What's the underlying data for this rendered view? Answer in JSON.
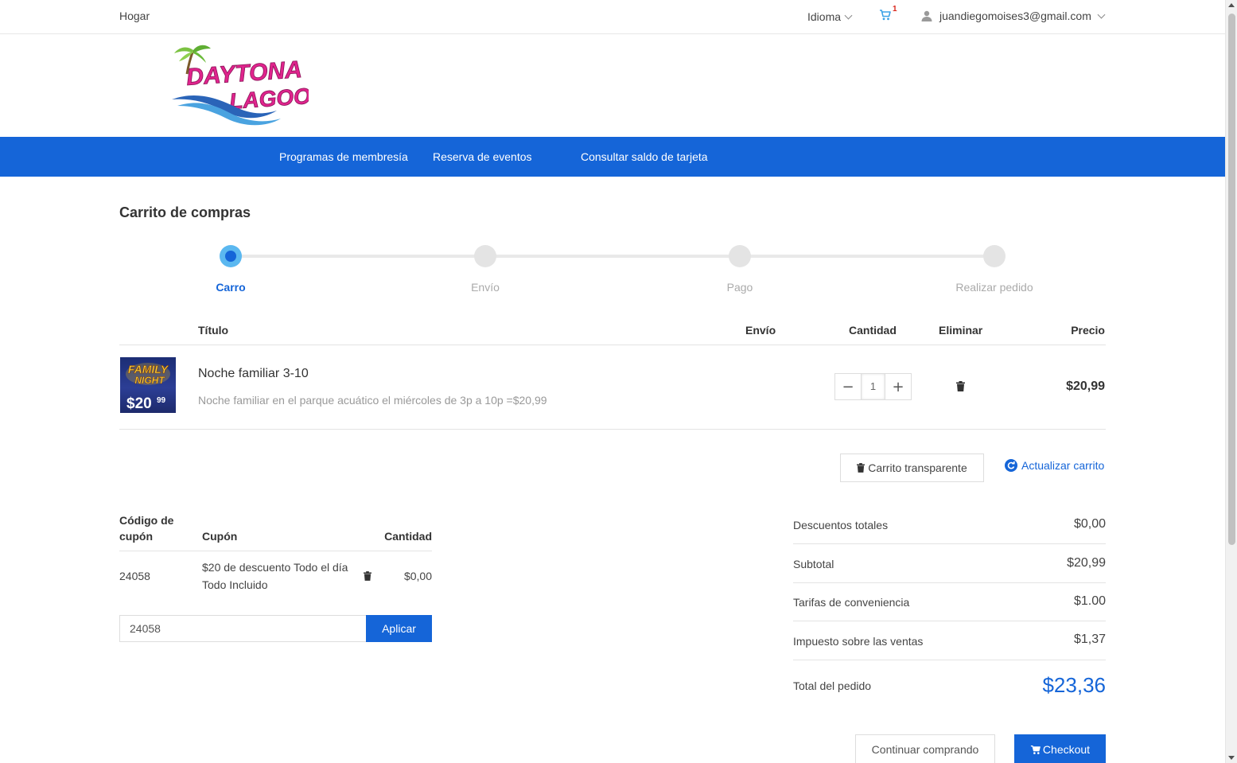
{
  "topbar": {
    "home": "Hogar",
    "language": "Idioma",
    "cart_count": "1",
    "user_email": "juandiegomoises3@gmail.com"
  },
  "logo": {
    "line1": "DAYTONA",
    "line2": "LAGOON"
  },
  "nav": {
    "items": [
      "Programas de membresía",
      "Reserva de eventos",
      "Consultar saldo de tarjeta"
    ]
  },
  "page_title": "Carrito de compras",
  "steps": [
    "Carro",
    "Envío",
    "Pago",
    "Realizar pedido"
  ],
  "active_step": 0,
  "cart_table": {
    "headers": {
      "title": "Título",
      "shipping": "Envío",
      "quantity": "Cantidad",
      "remove": "Eliminar",
      "price": "Precio"
    },
    "items": [
      {
        "title": "Noche familiar 3-10",
        "description": "Noche familiar en el parque acuático el miércoles de 3p a 10p =$20,99",
        "quantity": "1",
        "price": "$20,99",
        "image_text_top": "FAMILY",
        "image_text_mid": "NIGHT",
        "image_price": "$20",
        "image_cents": "99"
      }
    ]
  },
  "actions": {
    "clear_cart": "Carrito transparente",
    "update_cart": "Actualizar carrito"
  },
  "coupon_table": {
    "headers": {
      "code": "Código de cupón",
      "coupon": "Cupón",
      "amount": "Cantidad"
    },
    "rows": [
      {
        "code": "24058",
        "coupon": "$20 de descuento Todo el día Todo Incluido",
        "amount": "$0,00"
      }
    ],
    "input_value": "24058",
    "apply": "Aplicar"
  },
  "summary": {
    "discounts_label": "Descuentos totales",
    "discounts": "$0,00",
    "subtotal_label": "Subtotal",
    "subtotal": "$20,99",
    "fees_label": "Tarifas de conveniencia",
    "fees": "$1.00",
    "tax_label": "Impuesto sobre las ventas",
    "tax": "$1,37",
    "total_label": "Total del pedido",
    "total": "$23,36"
  },
  "buttons": {
    "continue": "Continuar comprando",
    "checkout": "Checkout"
  },
  "colors": {
    "primary": "#1565d8",
    "step_active_ring": "#5bb8f0",
    "badge": "#d9261c",
    "logo_pink": "#e0248d",
    "logo_blue": "#2a64b8"
  }
}
